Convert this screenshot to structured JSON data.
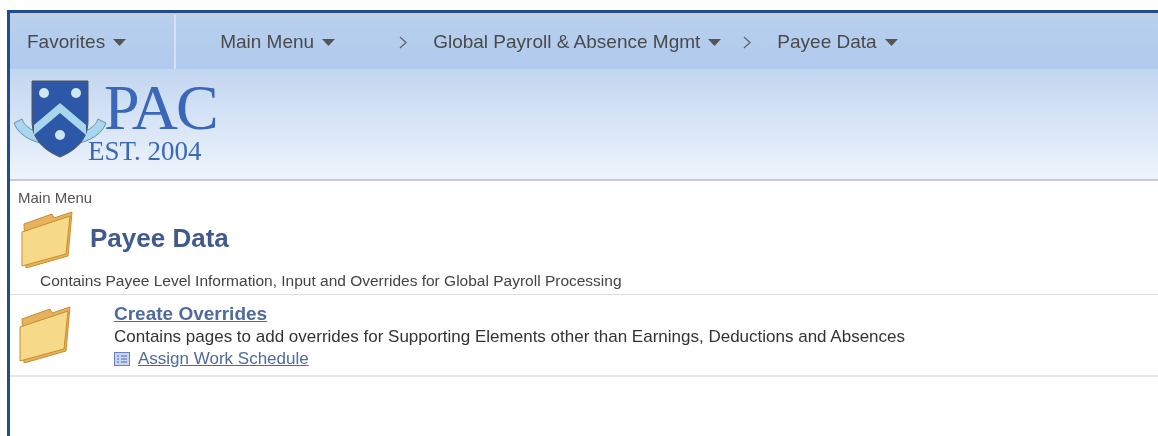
{
  "nav": {
    "items": [
      {
        "label": "Favorites",
        "kind": "root"
      },
      {
        "label": "Main Menu",
        "kind": "menu"
      },
      {
        "label": "Global Payroll & Absence Mgmt",
        "kind": "crumb"
      },
      {
        "label": "Payee Data",
        "kind": "crumb"
      }
    ]
  },
  "logo": {
    "name": "PAC",
    "established": "EST. 2004"
  },
  "breadcrumb": "Main Menu",
  "folder": {
    "title": "Payee Data",
    "description": "Contains Payee Level Information, Input and Overrides for Global Payroll Processing"
  },
  "subfolders": [
    {
      "title": "Create Overrides",
      "description": "Contains pages to add overrides for Supporting Elements other than Earnings, Deductions and Absences",
      "links": [
        "Assign Work Schedule"
      ]
    }
  ]
}
